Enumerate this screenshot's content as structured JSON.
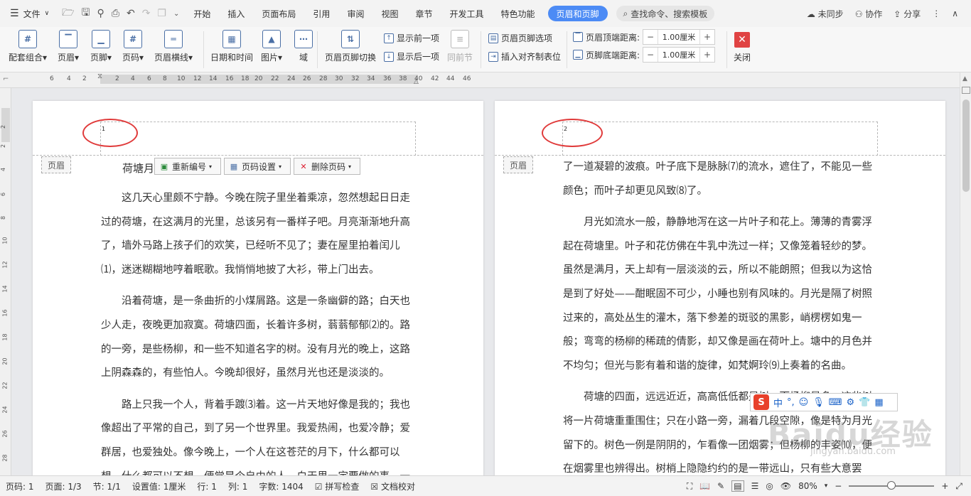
{
  "menubar": {
    "file_label": "文件",
    "tabs": [
      "开始",
      "插入",
      "页面布局",
      "引用",
      "审阅",
      "视图",
      "章节",
      "开发工具",
      "特色功能"
    ],
    "active_tab": "页眉和页脚",
    "search_label": "查找命令、搜索模板",
    "sync_label": "未同步",
    "collab_label": "协作",
    "share_label": "分享"
  },
  "ribbon": {
    "match_combo": "配套组合",
    "header": "页眉",
    "footer": "页脚",
    "page_number": "页码",
    "header_line": "页眉横线",
    "date_time": "日期和时间",
    "picture": "图片",
    "field": "域",
    "switch": "页眉页脚切换",
    "show_prev": "显示前一项",
    "show_next": "显示后一项",
    "same_as_prev": "同前节",
    "options": "页眉页脚选项",
    "insert_tab": "插入对齐制表位",
    "header_top_label": "页眉顶端距离:",
    "header_top_value": "1.00厘米",
    "footer_bottom_label": "页脚底端距离:",
    "footer_bottom_value": "1.00厘米",
    "close": "关闭"
  },
  "ruler": {
    "h_ticks": [
      "6",
      "4",
      "2",
      "2",
      "4",
      "6",
      "8",
      "10",
      "12",
      "14",
      "16",
      "18",
      "20",
      "22",
      "24",
      "26",
      "28",
      "30",
      "32",
      "34",
      "36",
      "38",
      "40",
      "42",
      "44",
      "46"
    ],
    "v_ticks": [
      "2",
      "2",
      "4",
      "6",
      "8",
      "10",
      "12",
      "14",
      "16",
      "18",
      "20",
      "22",
      "24",
      "26",
      "28"
    ]
  },
  "page1": {
    "page_number": "1",
    "header_label": "页眉",
    "title_partial": "荷塘月",
    "btn_renumber": "重新编号",
    "btn_page_setup": "页码设置",
    "btn_delete": "删除页码",
    "paragraphs": [
      "这几天心里颇不宁静。今晚在院子里坐着乘凉，忽然想起日日走过的荷塘，在这满月的光里，总该另有一番样子吧。月亮渐渐地升高了，墙外马路上孩子们的欢笑，已经听不见了；妻在屋里拍着闰儿⑴，迷迷糊糊地哼着眠歌。我悄悄地披了大衫，带上门出去。",
      "沿着荷塘，是一条曲折的小煤屑路。这是一条幽僻的路；白天也少人走，夜晚更加寂寞。荷塘四面，长着许多树，蓊蓊郁郁⑵的。路的一旁，是些杨柳，和一些不知道名字的树。没有月光的晚上，这路上阴森森的，有些怕人。今晚却很好，虽然月光也还是淡淡的。",
      "路上只我一个人，背着手踱⑶着。这一片天地好像是我的；我也像超出了平常的自己，到了另一个世界里。我爱热闹，也爱冷静；爱群居，也爱独处。像今晚上，一个人在这苍茫的月下，什么都可以想，什么都可以不想，便觉是个自由的人。白天里一定要做的事，一定要说的话"
    ]
  },
  "page2": {
    "page_number": "2",
    "header_label": "页眉",
    "paragraphs": [
      "了一道凝碧的波痕。叶子底下是脉脉⑺的流水，遮住了，不能见一些颜色；而叶子却更见风致⑻了。",
      "月光如流水一般，静静地泻在这一片叶子和花上。薄薄的青雾浮起在荷塘里。叶子和花仿佛在牛乳中洗过一样；又像笼着轻纱的梦。虽然是满月，天上却有一层淡淡的云，所以不能朗照；但我以为这恰是到了好处——酣眠固不可少，小睡也别有风味的。月光是隔了树照过来的，高处丛生的灌木，落下参差的斑驳的黑影，峭楞楞如鬼一般；弯弯的杨柳的稀疏的倩影，却又像是画在荷叶上。塘中的月色并不均匀；但光与影有着和谐的旋律，如梵婀玲⑼上奏着的名曲。",
      "荷塘的四面，远远近近，高高低低都是树，而杨柳最多。这些树将一片荷塘重重围住；只在小路一旁，漏着几段空隙，像是特为月光留下的。树色一例是阴阴的，乍看像一团烟雾；但杨柳的丰姿⑽，便在烟雾里也辨得出。树梢上隐隐约约的是一带远山，只有些大意罢了。"
    ]
  },
  "ime": {
    "logo": "S",
    "mode": "中"
  },
  "watermark": {
    "text": "Baidu经验",
    "sub": "jingyan.baidu.com"
  },
  "status": {
    "page_code": "页码: 1",
    "pages": "页面: 1/3",
    "section": "节: 1/1",
    "setting": "设置值: 1厘米",
    "row": "行: 1",
    "col": "列: 1",
    "words": "字数: 1404",
    "spell": "拼写检查",
    "proof": "文档校对",
    "zoom": "80%"
  },
  "colors": {
    "accent": "#4c8bf5",
    "close_red": "#e04343",
    "circle_red": "#e03a3a"
  }
}
